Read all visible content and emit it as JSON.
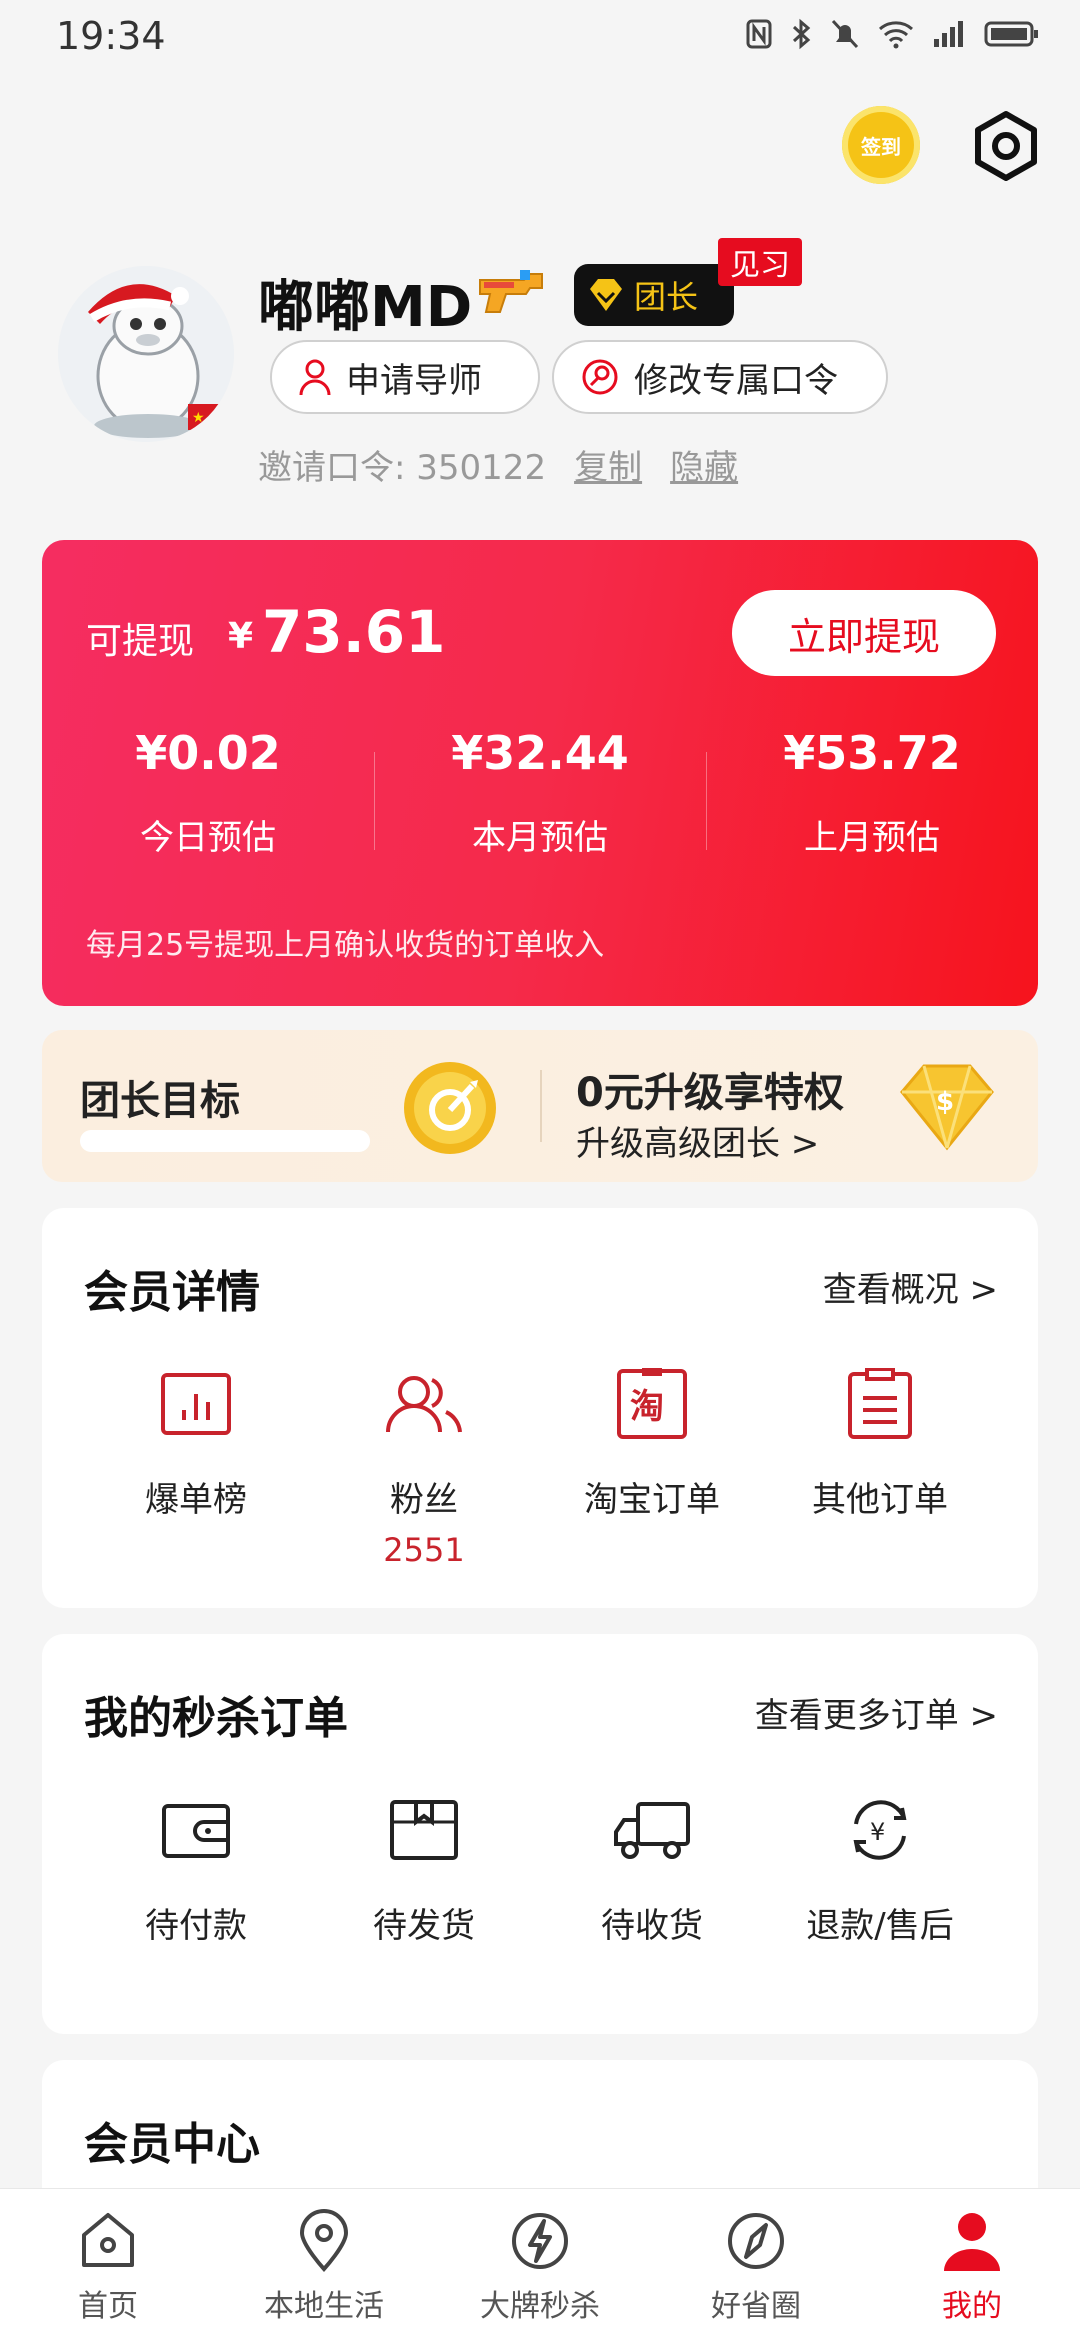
{
  "status_bar": {
    "time": "19:34"
  },
  "header": {
    "signin_label": "签到"
  },
  "profile": {
    "nickname": "嘟嘟MD",
    "badge_label": "团长",
    "trial_label": "见习",
    "apply_mentor": "申请导师",
    "edit_code": "修改专属口令",
    "invite_label": "邀请口令:",
    "invite_code": "350122",
    "copy": "复制",
    "hide": "隐藏"
  },
  "earnings": {
    "withdrawable_label": "可提现",
    "currency": "¥",
    "withdrawable_amount": "73.61",
    "withdraw_button": "立即提现",
    "stats": [
      {
        "value": "¥0.02",
        "label": "今日预估"
      },
      {
        "value": "¥32.44",
        "label": "本月预估"
      },
      {
        "value": "¥53.72",
        "label": "上月预估"
      }
    ],
    "note": "每月25号提现上月确认收货的订单收入"
  },
  "captain": {
    "goal_title": "团长目标",
    "goal_progress": 0,
    "upgrade_title": "0元升级享特权",
    "upgrade_sub": "升级高级团长 >"
  },
  "member_details": {
    "title": "会员详情",
    "more": "查看概况 >",
    "items": [
      {
        "label": "爆单榜",
        "icon": "chart-icon"
      },
      {
        "label": "粉丝",
        "count": "2551",
        "icon": "fans-icon"
      },
      {
        "label": "淘宝订单",
        "icon": "taobao-icon",
        "glyph": "淘"
      },
      {
        "label": "其他订单",
        "icon": "orders-icon"
      }
    ]
  },
  "flash_orders": {
    "title": "我的秒杀订单",
    "more": "查看更多订单 >",
    "items": [
      {
        "label": "待付款",
        "icon": "wallet-icon"
      },
      {
        "label": "待发货",
        "icon": "box-icon"
      },
      {
        "label": "待收货",
        "icon": "truck-icon"
      },
      {
        "label": "退款/售后",
        "icon": "refund-icon"
      }
    ]
  },
  "member_center": {
    "title": "会员中心"
  },
  "nav": [
    {
      "label": "首页",
      "icon": "home-icon"
    },
    {
      "label": "本地生活",
      "icon": "location-icon"
    },
    {
      "label": "大牌秒杀",
      "icon": "flash-icon"
    },
    {
      "label": "好省圈",
      "icon": "compass-icon"
    },
    {
      "label": "我的",
      "icon": "profile-icon",
      "active": true
    }
  ],
  "colors": {
    "accent": "#e60c1f",
    "card_start": "#f52d61",
    "card_end": "#f6131d",
    "gold": "#f5c316"
  }
}
